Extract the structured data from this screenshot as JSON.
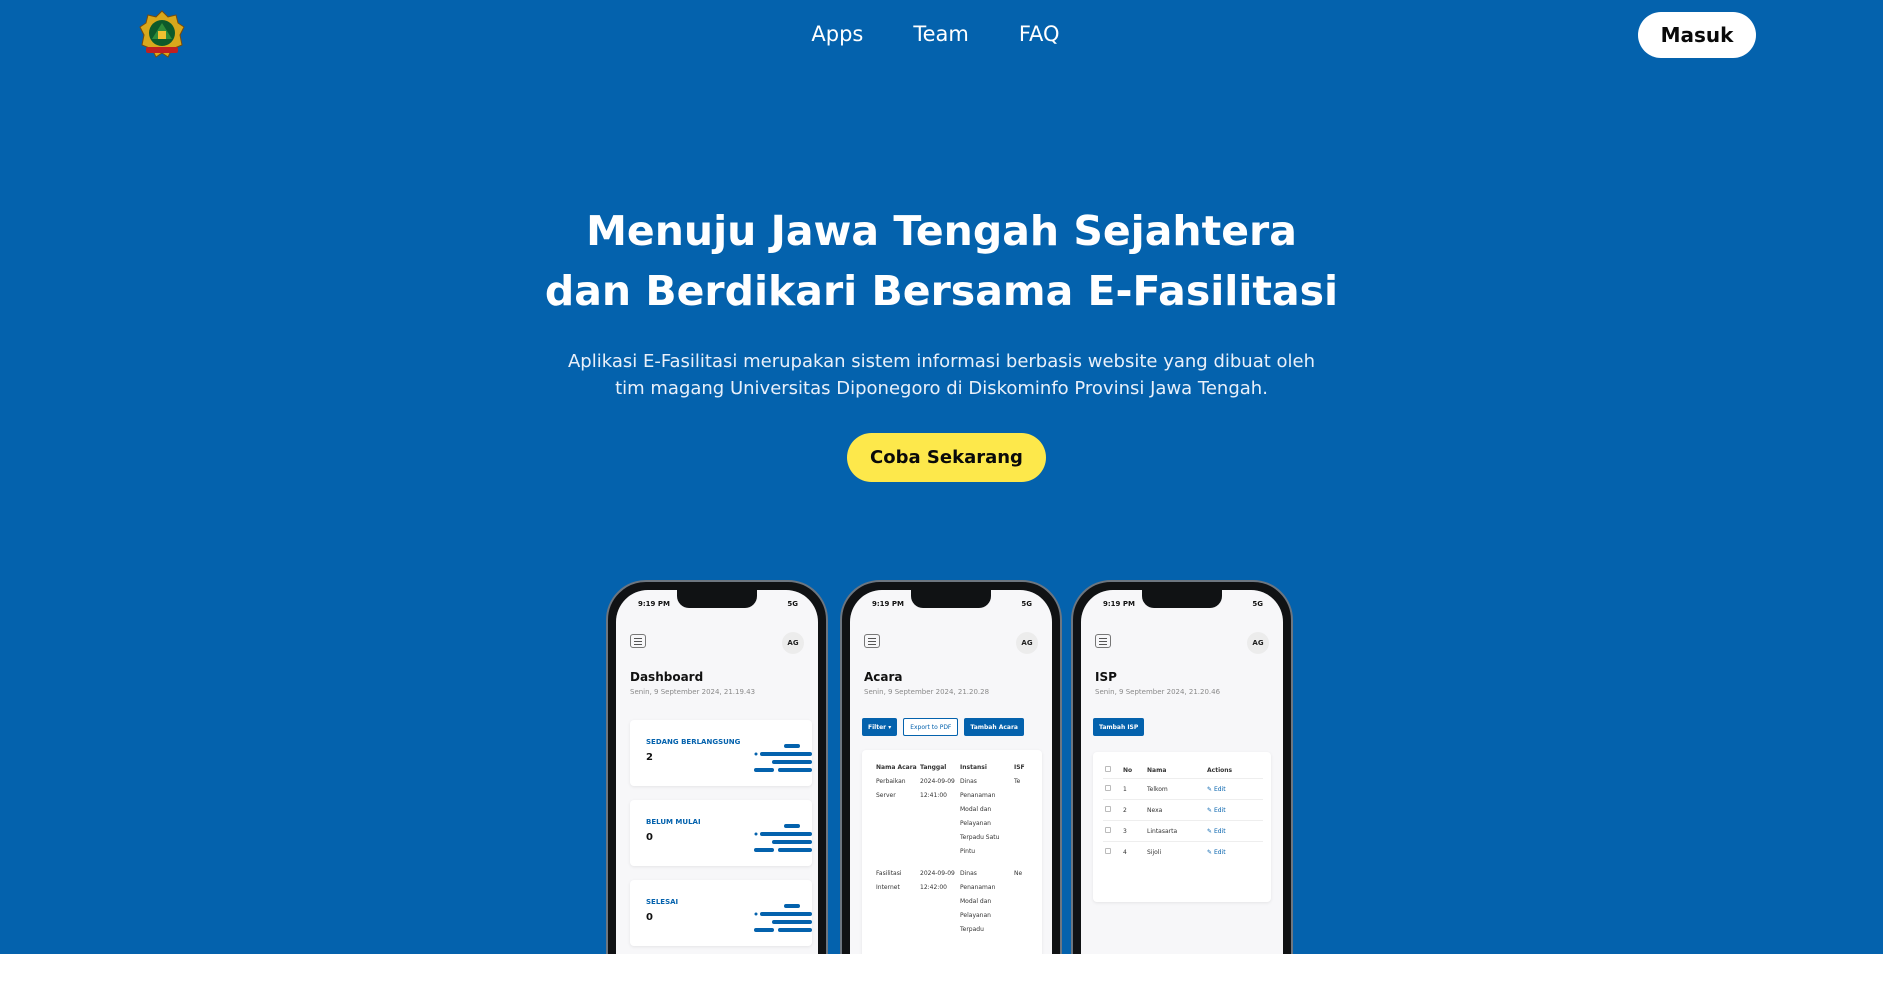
{
  "header": {
    "logo_alt": "Logo Provinsi Jawa Tengah",
    "nav": [
      "Apps",
      "Team",
      "FAQ"
    ],
    "login_label": "Masuk"
  },
  "hero": {
    "headline_line1": "Menuju Jawa Tengah Sejahtera",
    "headline_line2": "dan Berdikari Bersama E-Fasilitasi",
    "subtext_line1": "Aplikasi E-Fasilitasi merupakan sistem informasi berbasis website yang dibuat oleh",
    "subtext_line2": "tim magang Universitas Diponegoro di Diskominfo Provinsi Jawa Tengah.",
    "cta_label": "Coba Sekarang"
  },
  "phones": {
    "status_time": "9:19 PM",
    "status_signal": "5G",
    "avatar": "AG",
    "dashboard": {
      "title": "Dashboard",
      "date": "Senin, 9 September 2024, 21.19.43",
      "cards": [
        {
          "label": "SEDANG BERLANGSUNG",
          "value": "2"
        },
        {
          "label": "BELUM MULAI",
          "value": "0"
        },
        {
          "label": "SELESAI",
          "value": "0"
        }
      ]
    },
    "acara": {
      "title": "Acara",
      "date": "Senin, 9 September 2024, 21.20.28",
      "buttons": {
        "filter": "Filter",
        "export": "Export to PDF",
        "add": "Tambah Acara"
      },
      "columns": [
        "Nama Acara",
        "Tanggal",
        "Instansi",
        "ISF"
      ],
      "rows": [
        {
          "nama": "Perbaikan Server",
          "tanggal": "2024-09-09 12:41:00",
          "instansi": "Dinas Penanaman Modal dan Pelayanan Terpadu Satu Pintu",
          "isp": "Te"
        },
        {
          "nama": "Fasilitasi Internet",
          "tanggal": "2024-09-09 12:42:00",
          "instansi": "Dinas Penanaman Modal dan Pelayanan Terpadu",
          "isp": "Ne"
        }
      ]
    },
    "isp": {
      "title": "ISP",
      "date": "Senin, 9 September 2024, 21.20.46",
      "add_button": "Tambah ISP",
      "columns": [
        "No",
        "Nama",
        "Actions"
      ],
      "rows": [
        {
          "no": "1",
          "nama": "Telkom",
          "action": "Edit"
        },
        {
          "no": "2",
          "nama": "Nexa",
          "action": "Edit"
        },
        {
          "no": "3",
          "nama": "Lintasarta",
          "action": "Edit"
        },
        {
          "no": "4",
          "nama": "Sijoli",
          "action": "Edit"
        }
      ]
    }
  },
  "colors": {
    "hero_bg": "#0462ad",
    "cta_bg": "#fde84b",
    "login_bg": "#ffffff"
  }
}
